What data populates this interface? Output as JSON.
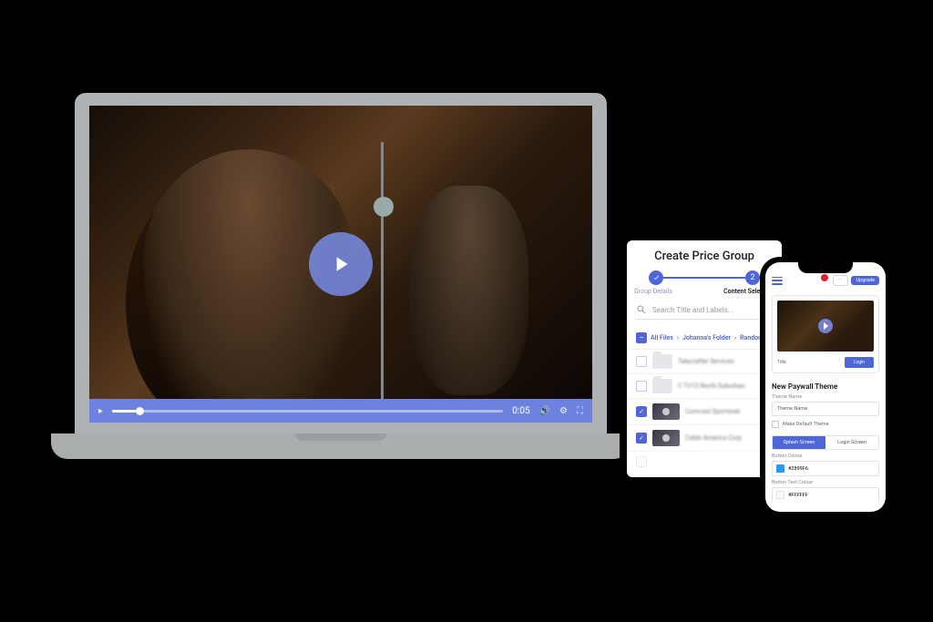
{
  "video": {
    "time": "0:05",
    "play_icon": "play-icon",
    "colors": {
      "bar": "#6d82df"
    }
  },
  "tablet": {
    "title": "Create Price Group",
    "step1_label": "Group Details",
    "step2_label": "Content Selection",
    "search_placeholder": "Search Title and Labels...",
    "breadcrumb": {
      "root": "All Files",
      "sep": "›",
      "folder": "Johanna's Folder",
      "leaf": "Random"
    },
    "rows": [
      {
        "checked": false,
        "kind": "folder",
        "label": "Telecrafter Services"
      },
      {
        "checked": false,
        "kind": "folder",
        "label": "C TV13 North Suburban"
      },
      {
        "checked": true,
        "kind": "video",
        "label": "Comcast Sportsnet"
      },
      {
        "checked": true,
        "kind": "video",
        "label": "Cable America Corp"
      }
    ]
  },
  "phone": {
    "upgrade": "Upgrade",
    "preview_title": "Title",
    "login": "Login",
    "section_title": "New Paywall Theme",
    "theme_name_label": "Theme Name",
    "theme_name_value": "Theme Name",
    "make_default": "Make Default Theme",
    "tab_splash": "Splash Screen",
    "tab_login": "Login Screen",
    "button_colour_label": "Button Colour",
    "button_colour_value": "#2899F6",
    "button_text_colour_label": "Button Text Colour",
    "button_text_colour_value": "#FFFFFF"
  }
}
